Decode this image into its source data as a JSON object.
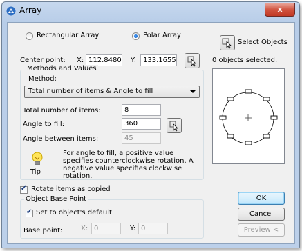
{
  "window": {
    "title": "Array",
    "close_label": "x"
  },
  "array_type": {
    "rectangular": {
      "label": "Rectangular Array",
      "selected": false
    },
    "polar": {
      "label": "Polar Array",
      "selected": true
    }
  },
  "center_point": {
    "label": "Center point:",
    "x_label": "X:",
    "x_value": "112.8480:",
    "y_label": "Y:",
    "y_value": "133.1655:"
  },
  "methods": {
    "group_label": "Methods and Values",
    "method_label": "Method:",
    "method_selected": "Total number of items & Angle to fill",
    "total_items_label": "Total number of items:",
    "total_items_value": "8",
    "angle_fill_label": "Angle to fill:",
    "angle_fill_value": "360",
    "angle_between_label": "Angle between items:",
    "angle_between_value": "45",
    "tip_text": "For angle to fill, a positive value specifies counterclockwise rotation.  A negative value specifies clockwise rotation.",
    "tip_label": "Tip"
  },
  "rotate_items": {
    "label": "Rotate items as copied",
    "checked": true
  },
  "base_point": {
    "group_label": "Object Base Point",
    "default_label": "Set to object's default",
    "default_checked": true,
    "label": "Base point:",
    "x_label": "X:",
    "x_value": "0",
    "y_label": "Y:",
    "y_value": "0"
  },
  "select_objects": {
    "label": "Select Objects",
    "status": "0 objects selected."
  },
  "buttons": {
    "ok": "OK",
    "cancel": "Cancel",
    "preview": "Preview <"
  },
  "colors": {
    "accent": "#3c7fb1",
    "titlebar": "#c6d8ee",
    "close": "#c9472f"
  }
}
